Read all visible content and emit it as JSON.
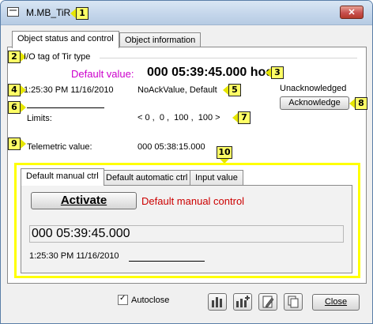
{
  "window": {
    "title": "M.MB_TiR",
    "close_glyph": "✕"
  },
  "tabs": [
    {
      "label": "Object status and control"
    },
    {
      "label": "Object information"
    }
  ],
  "status": {
    "io_tag": "I/O tag of Tir type",
    "default_value_label": "Default value:",
    "default_value": "000 05:39:45.000 hod.",
    "timestamp": "1:25:30 PM 11/16/2010",
    "flags": "NoAckValue, Default",
    "ack_state": "Unacknowledged",
    "acknowledge_label": "Acknowledge",
    "limits_label": "Limits:",
    "limits_value": "< 0 ,  0 ,  100 ,  100 >",
    "telemetric_label": "Telemetric value:",
    "telemetric_value": "000 05:38:15.000"
  },
  "control": {
    "tabs": [
      {
        "label": "Default manual ctrl"
      },
      {
        "label": "Default automatic ctrl"
      },
      {
        "label": "Input value"
      }
    ],
    "activate_label": "Activate",
    "mode_text": "Default manual control",
    "value": "000 05:39:45.000",
    "timestamp": "1:25:30 PM 11/16/2010"
  },
  "footer": {
    "autoclose_label": "Autoclose",
    "autoclose_checked": "✓",
    "close_label": "Close"
  },
  "markers": [
    "1",
    "2",
    "3",
    "4",
    "5",
    "6",
    "7",
    "8",
    "9",
    "10"
  ],
  "colors": {
    "default_value_label": "#cc00cc",
    "mode_text": "#cc0000",
    "marker_fill": "#ffff66",
    "highlight_border": "#ffff00"
  }
}
